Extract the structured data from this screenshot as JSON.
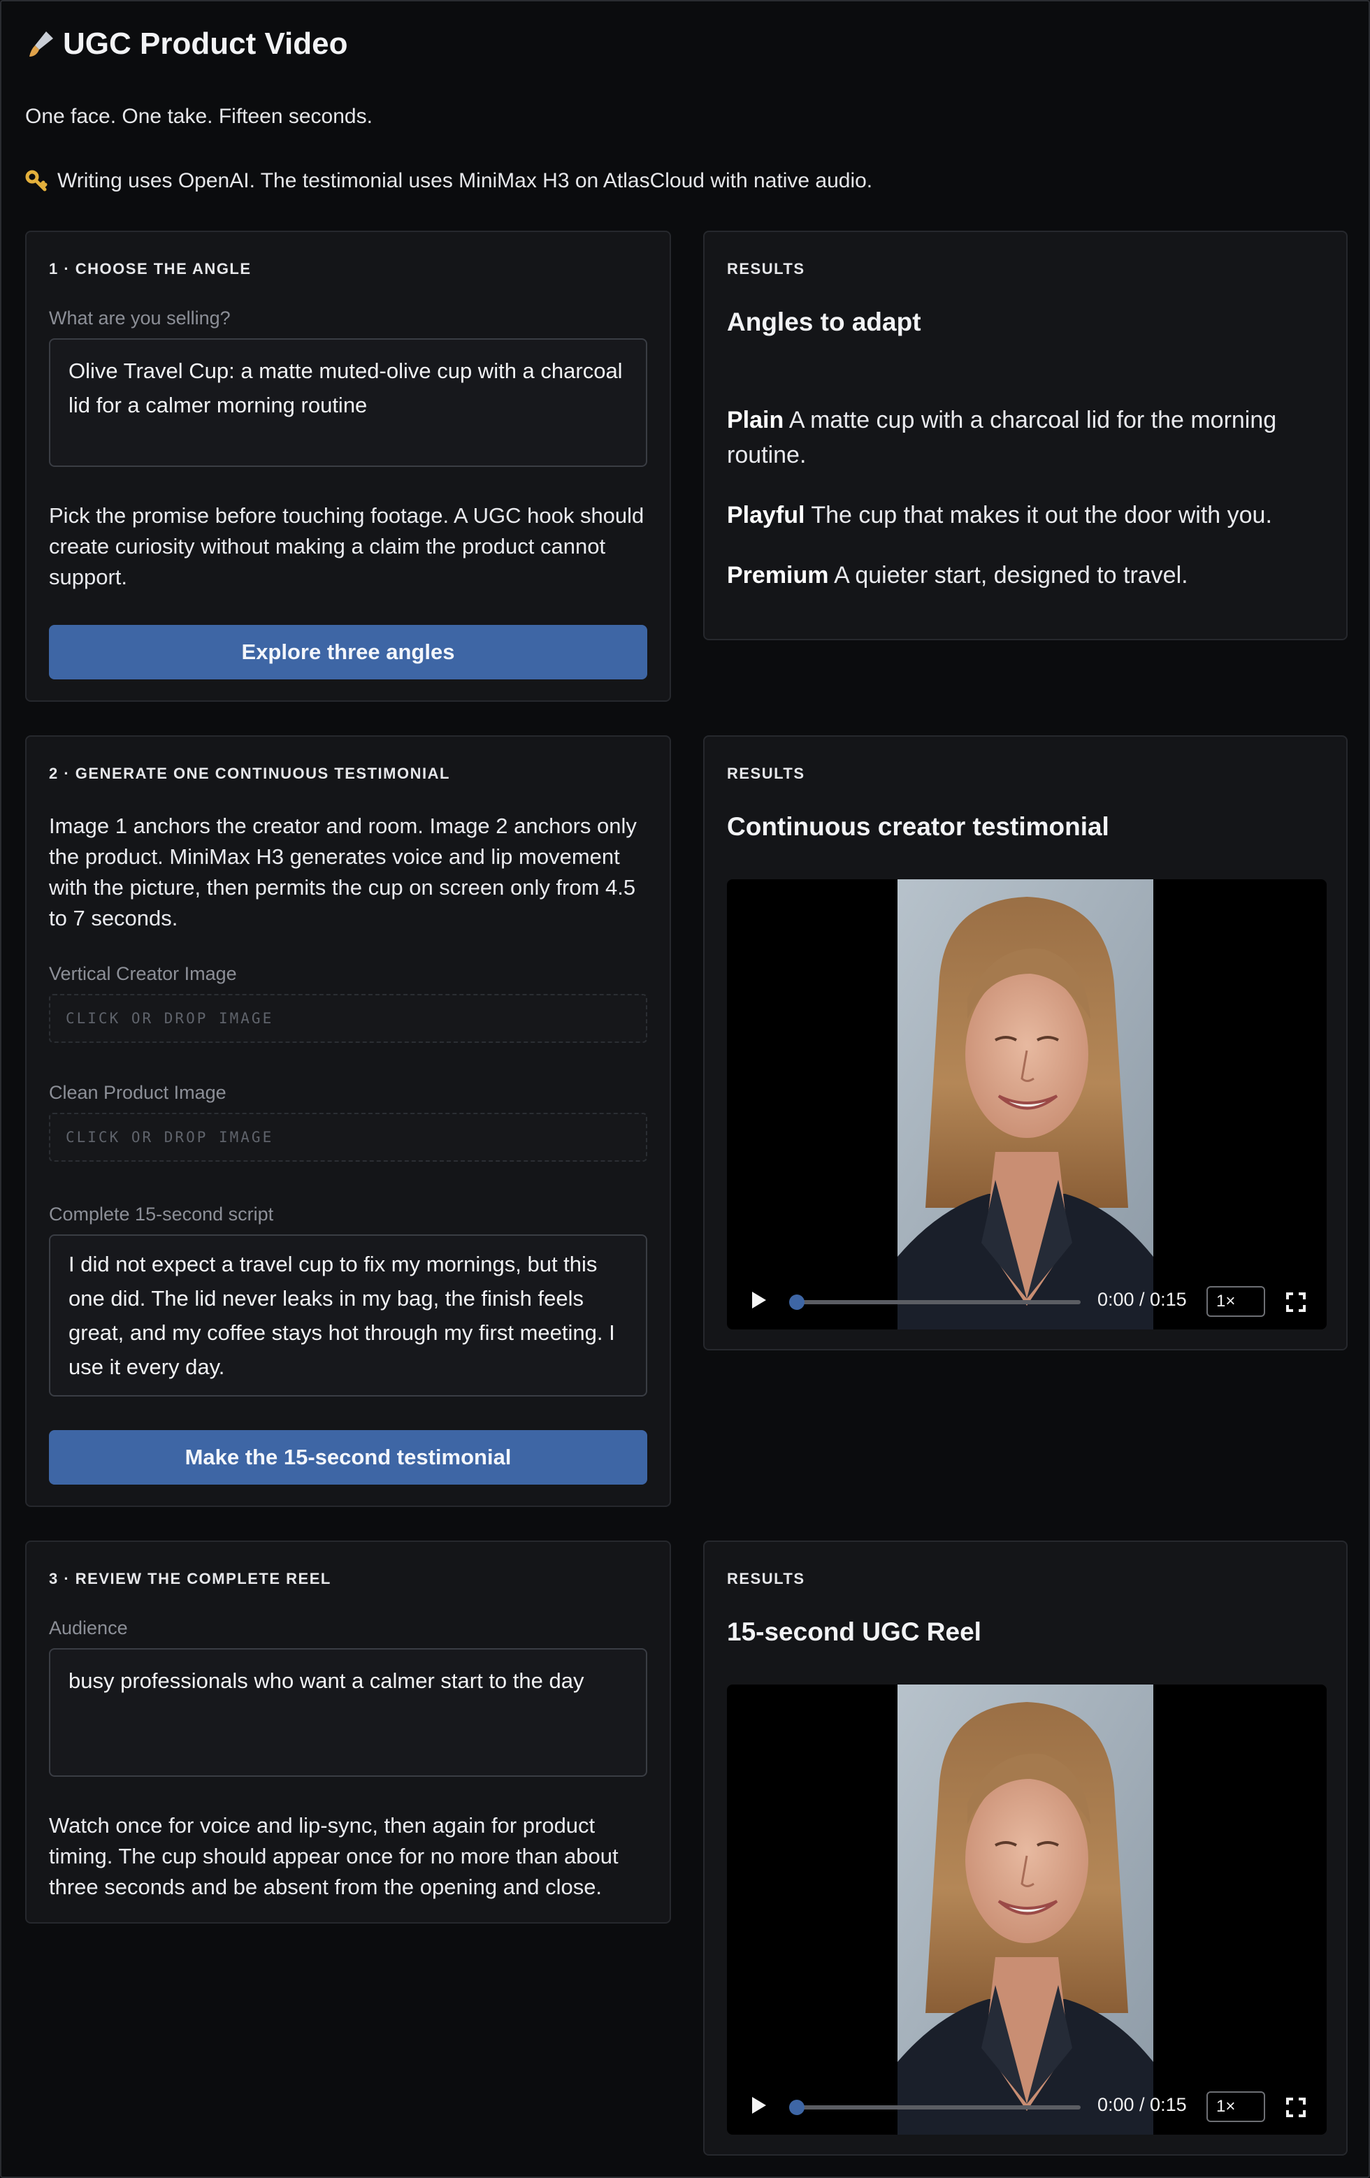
{
  "app": {
    "title": "UGC Product Video",
    "title_icon": "paintbrush-icon",
    "tagline": "One face. One take. Fifteen seconds.",
    "notice_icon": "key-icon",
    "notice": "Writing uses OpenAI. The testimonial uses MiniMax H3 on AtlasCloud with native audio."
  },
  "step1": {
    "label": "1 · CHOOSE THE ANGLE",
    "field_label": "What are you selling?",
    "field_value": "Olive Travel Cup: a matte muted-olive cup with a charcoal lid for a calmer morning routine",
    "description": "Pick the promise before touching footage. A UGC hook should create curiosity without making a claim the product cannot support.",
    "button": "Explore three angles"
  },
  "results1": {
    "label": "RESULTS",
    "title": "Angles to adapt",
    "angles": [
      {
        "name": "Plain",
        "text": "A matte cup with a charcoal lid for the morning routine."
      },
      {
        "name": "Playful",
        "text": "The cup that makes it out the door with you."
      },
      {
        "name": "Premium",
        "text": "A quieter start, designed to travel."
      }
    ]
  },
  "step2": {
    "label": "2 · GENERATE ONE CONTINUOUS TESTIMONIAL",
    "description": "Image 1 anchors the creator and room. Image 2 anchors only the product. MiniMax H3 generates voice and lip movement with the picture, then permits the cup on screen only from 4.5 to 7 seconds.",
    "creator_label": "Vertical Creator Image",
    "creator_drop": "CLICK OR DROP IMAGE",
    "product_label": "Clean Product Image",
    "product_drop": "CLICK OR DROP IMAGE",
    "script_label": "Complete 15-second script",
    "script_value": "I did not expect a travel cup to fix my mornings, but this one did. The lid never leaks in my bag, the finish feels great, and my coffee stays hot through my first meeting. I use it every day.",
    "button": "Make the 15-second testimonial"
  },
  "results2": {
    "label": "RESULTS",
    "title": "Continuous creator testimonial",
    "player": {
      "time": "0:00 / 0:15",
      "speed": "1×",
      "progress": 0.02
    }
  },
  "step3": {
    "label": "3 · REVIEW THE COMPLETE REEL",
    "field_label": "Audience",
    "field_value": "busy professionals who want a calmer start to the day",
    "description": "Watch once for voice and lip-sync, then again for product timing. The cup should appear once for no more than about three seconds and be absent from the opening and close."
  },
  "results3": {
    "label": "RESULTS",
    "title": "15-second UGC Reel",
    "player": {
      "time": "0:00 / 0:15",
      "speed": "1×",
      "progress": 0.02
    }
  },
  "colors": {
    "accent": "#3e66a5",
    "background": "#0b0c0e",
    "card": "#141518"
  }
}
